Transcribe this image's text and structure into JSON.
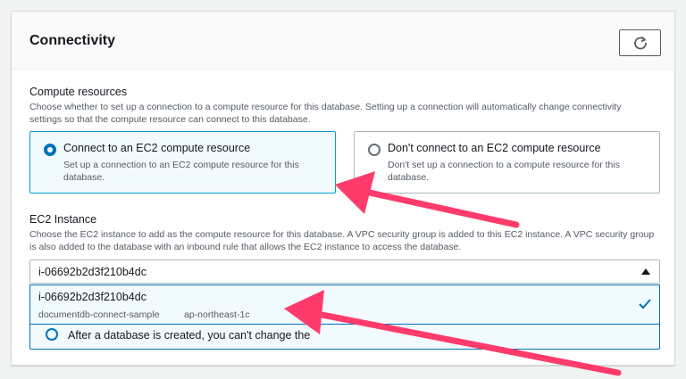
{
  "panel": {
    "title": "Connectivity"
  },
  "compute_resources": {
    "label": "Compute resources",
    "description": "Choose whether to set up a connection to a compute resource for this database. Setting up a connection will automatically change connectivity settings so that the compute resource can connect to this database.",
    "options": [
      {
        "title": "Connect to an EC2 compute resource",
        "description": "Set up a connection to an EC2 compute resource for this database.",
        "selected": true
      },
      {
        "title": "Don't connect to an EC2 compute resource",
        "description": "Don't set up a connection to a compute resource for this database.",
        "selected": false
      }
    ]
  },
  "ec2_instance": {
    "label": "EC2 Instance",
    "description": "Choose the EC2 instance to add as the compute resource for this database. A VPC security group is added to this EC2 instance. A VPC security group is also added to the database with an inbound rule that allows the EC2 instance to access the database.",
    "selected_value": "i-06692b2d3f210b4dc",
    "dropdown_option": {
      "label": "i-06692b2d3f210b4dc",
      "name_tag": "documentdb-connect-sample",
      "region_tag": "ap-northeast-1c"
    }
  },
  "alert": {
    "text": "After a database is created, you can't change the"
  },
  "colors": {
    "accent": "#0073bb",
    "annotation_arrow": "#ff3b6b"
  }
}
